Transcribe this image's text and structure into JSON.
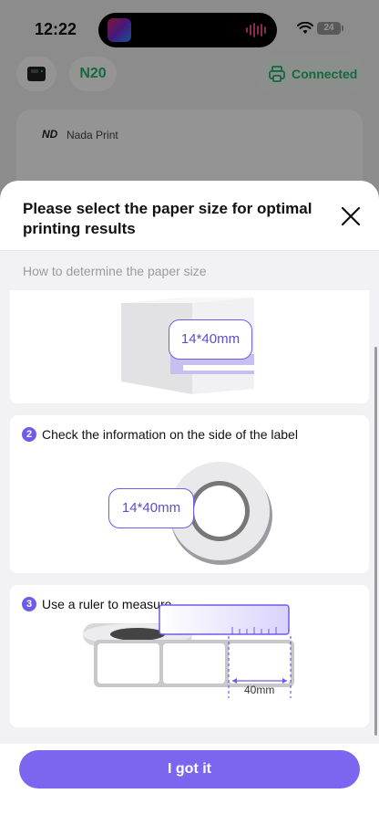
{
  "status_bar": {
    "time": "12:22",
    "battery": "24"
  },
  "background": {
    "printer_model": "N20",
    "connection_status": "Connected",
    "brand_logo": "ND",
    "brand_name": "Nada Print"
  },
  "sheet": {
    "title": "Please select the paper size for optimal printing results",
    "section_hint": "How to determine the paper size",
    "box_label": "14*40mm",
    "steps": [
      {
        "number": "2",
        "text": "Check the information on the side of the label",
        "label_size": "14*40mm"
      },
      {
        "number": "3",
        "text": "Use a ruler to measure",
        "measure": "40mm"
      }
    ],
    "confirm_button": "I got it"
  },
  "colors": {
    "accent": "#7c66ef",
    "connected_green": "#29b36a"
  }
}
